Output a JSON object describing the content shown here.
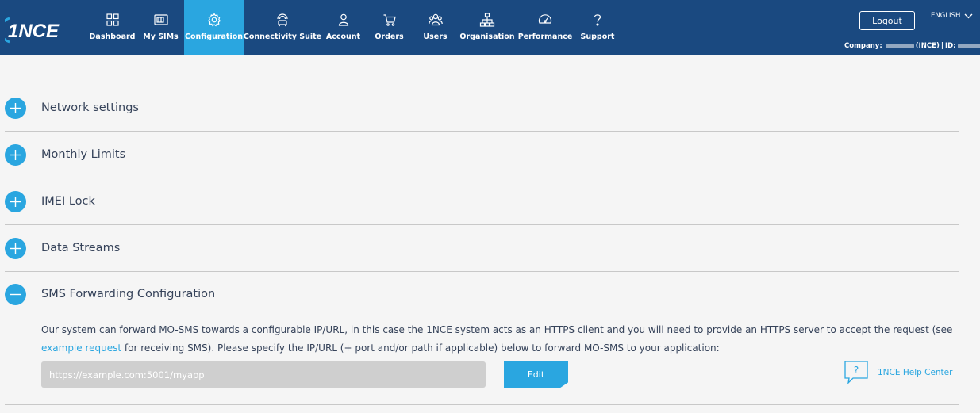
{
  "brand": {
    "logo_text": "1NCE"
  },
  "nav": [
    {
      "label": "Dashboard",
      "icon": "dashboard-icon",
      "active": false
    },
    {
      "label": "My SIMs",
      "icon": "sim-card-icon",
      "active": false
    },
    {
      "label": "Configuration",
      "icon": "gear-icon",
      "active": true
    },
    {
      "label": "Connectivity Suite",
      "icon": "connectivity-suite-icon",
      "active": false
    },
    {
      "label": "Account",
      "icon": "user-icon",
      "active": false
    },
    {
      "label": "Orders",
      "icon": "cart-icon",
      "active": false
    },
    {
      "label": "Users",
      "icon": "users-icon",
      "active": false
    },
    {
      "label": "Organisation",
      "icon": "org-chart-icon",
      "active": false
    },
    {
      "label": "Performance",
      "icon": "gauge-icon",
      "active": false
    },
    {
      "label": "Support",
      "icon": "question-icon",
      "active": false
    }
  ],
  "header": {
    "logout_label": "Logout",
    "language": "ENGLISH",
    "company_label": "Company:",
    "company_suffix": "(INCE)",
    "id_label": "ID:"
  },
  "sections": [
    {
      "title": "Network settings",
      "expanded": false
    },
    {
      "title": "Monthly Limits",
      "expanded": false
    },
    {
      "title": "IMEI Lock",
      "expanded": false
    },
    {
      "title": "Data Streams",
      "expanded": false
    },
    {
      "title": "SMS Forwarding Configuration",
      "expanded": true
    }
  ],
  "sms": {
    "desc_before": "Our system can forward MO-SMS towards a configurable IP/URL, in this case the 1NCE system acts as an HTTPS client and you will need to provide an HTTPS server to accept the request (see ",
    "desc_link": "example request",
    "desc_after": " for receiving SMS). Please specify the IP/URL (+ port and/or path if applicable) below to forward MO-SMS to your application:",
    "input_value": "",
    "input_placeholder": "https://example.com:5001/myapp",
    "edit_label": "Edit",
    "help_label": "1NCE Help Center"
  },
  "colors": {
    "topbar": "#1a4980",
    "accent": "#2aa6e0",
    "background": "#f5f5f5",
    "text": "#36435a"
  }
}
